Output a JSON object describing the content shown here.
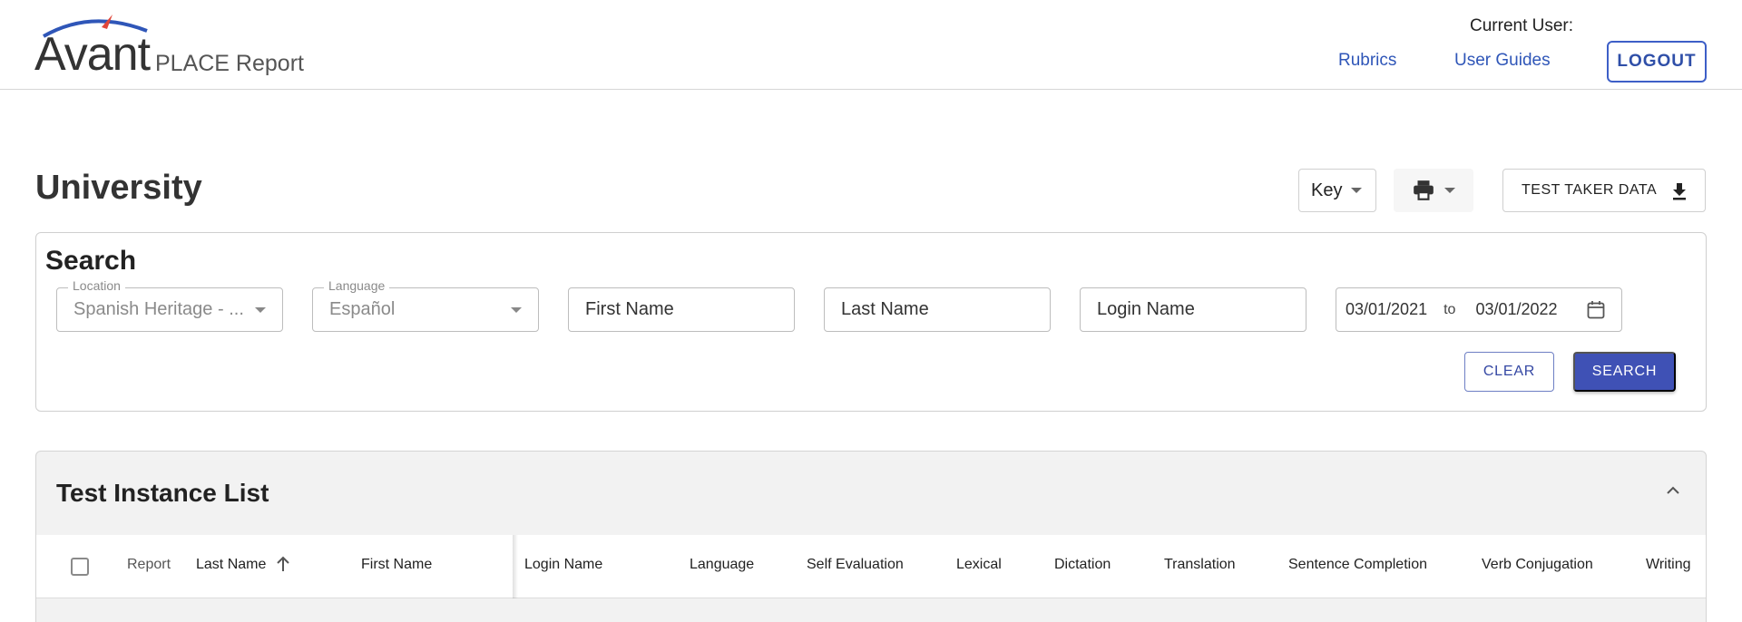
{
  "header": {
    "logo_word": "Avant",
    "logo_sub": "PLACE Report",
    "current_user_label": "Current User:",
    "nav": {
      "rubrics": "Rubrics",
      "user_guides": "User Guides"
    },
    "logout_label": "LOGOUT"
  },
  "page": {
    "title": "University",
    "key_label": "Key",
    "test_taker_label": "TEST TAKER DATA"
  },
  "search": {
    "title": "Search",
    "location": {
      "label": "Location",
      "value": "Spanish Heritage - ..."
    },
    "language": {
      "label": "Language",
      "value": "Español"
    },
    "first_name_placeholder": "First Name",
    "last_name_placeholder": "Last Name",
    "login_name_placeholder": "Login Name",
    "date_from": "03/01/2021",
    "date_to_label": "to",
    "date_to": "03/01/2022",
    "clear_label": "CLEAR",
    "search_label": "SEARCH"
  },
  "list": {
    "title": "Test Instance List",
    "columns": [
      "Report",
      "Last Name",
      "First Name",
      "Login Name",
      "Language",
      "Self Evaluation",
      "Lexical",
      "Dictation",
      "Translation",
      "Sentence Completion",
      "Verb Conjugation",
      "Writing"
    ]
  },
  "colors": {
    "primary": "#3f51b5",
    "link": "#2f56b8",
    "accent_red": "#e0463a"
  }
}
